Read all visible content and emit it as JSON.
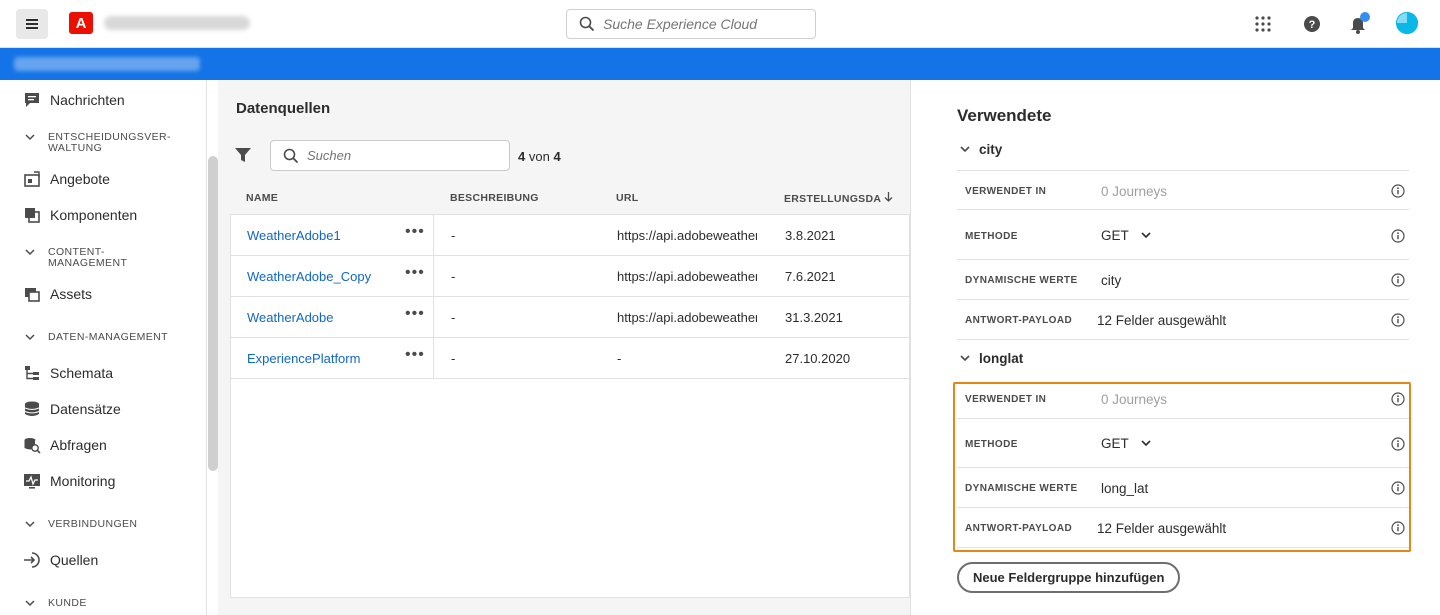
{
  "header": {
    "logo_letter": "A",
    "search_placeholder": "Suche Experience Cloud"
  },
  "sidebar": {
    "items": [
      {
        "label": "Nachrichten",
        "icon": "message-icon"
      },
      {
        "label": "Angebote",
        "icon": "offers-icon"
      },
      {
        "label": "Komponenten",
        "icon": "components-icon"
      },
      {
        "label": "Assets",
        "icon": "assets-icon"
      },
      {
        "label": "Schemata",
        "icon": "schema-icon"
      },
      {
        "label": "Datensätze",
        "icon": "datasets-icon"
      },
      {
        "label": "Abfragen",
        "icon": "queries-icon"
      },
      {
        "label": "Monitoring",
        "icon": "monitoring-icon"
      },
      {
        "label": "Quellen",
        "icon": "sources-icon"
      }
    ],
    "sections": [
      {
        "line1": "ENTSCHEIDUNGSVER-",
        "line2": "WALTUNG"
      },
      {
        "line1": "CONTENT-",
        "line2": "MANAGEMENT"
      },
      {
        "line1": "DATEN-MANAGEMENT",
        "line2": ""
      },
      {
        "line1": "VERBINDUNGEN",
        "line2": ""
      },
      {
        "line1": "KUNDE",
        "line2": ""
      }
    ]
  },
  "main": {
    "title": "Datenquellen",
    "search_placeholder": "Suchen",
    "count_shown": "4",
    "count_sep": "von",
    "count_total": "4",
    "columns": [
      "NAME",
      "BESCHREIBUNG",
      "URL",
      "ERSTELLUNGSDA"
    ],
    "rows": [
      {
        "name": "WeatherAdobe1",
        "more": "•••",
        "description": "-",
        "url": "https://api.adobeweather.org",
        "date": "3.8.2021"
      },
      {
        "name": "WeatherAdobe_Copy",
        "more": "•••",
        "description": "-",
        "url": "https://api.adobeweather.org",
        "date": "7.6.2021"
      },
      {
        "name": "WeatherAdobe",
        "more": "•••",
        "description": "-",
        "url": "https://api.adobeweather.org",
        "date": "31.3.2021"
      },
      {
        "name": "ExperiencePlatform",
        "more": "•••",
        "description": "-",
        "url": "-",
        "date": "27.10.2020"
      }
    ]
  },
  "panel": {
    "title": "Verwendete",
    "groups": [
      {
        "name": "city",
        "rows": [
          {
            "key": "VERWENDET IN",
            "value": "0 Journeys"
          },
          {
            "key": "METHODE",
            "value": "GET"
          },
          {
            "key": "DYNAMISCHE WERTE",
            "value": "city"
          },
          {
            "key": "ANTWORT-PAYLOAD",
            "value": "12  Felder ausgewählt"
          }
        ]
      },
      {
        "name": "longlat",
        "rows": [
          {
            "key": "VERWENDET IN",
            "value": "0 Journeys"
          },
          {
            "key": "METHODE",
            "value": "GET"
          },
          {
            "key": "DYNAMISCHE WERTE",
            "value": "long_lat"
          },
          {
            "key": "ANTWORT-PAYLOAD",
            "value": "12  Felder ausgewählt"
          }
        ]
      }
    ],
    "add_button": "Neue Feldergruppe hinzufügen",
    "highlight_color": "#e68619"
  },
  "colors": {
    "accent": "#1473e6",
    "link": "#1067c9",
    "brand": "#eb1000"
  }
}
